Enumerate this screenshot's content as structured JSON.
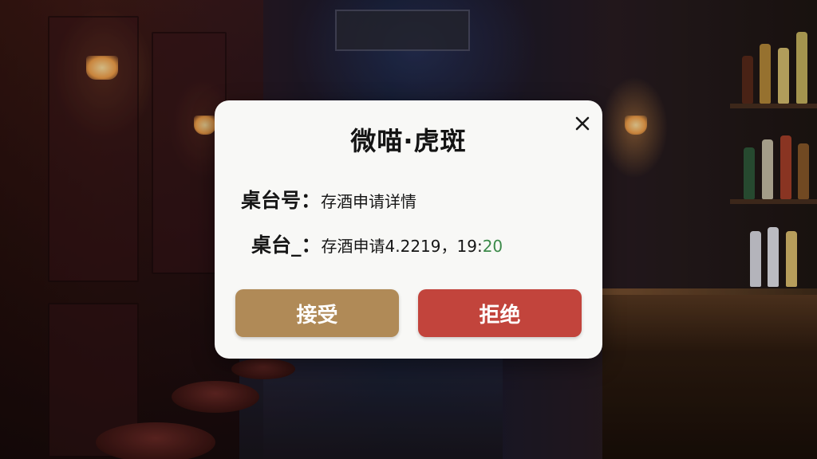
{
  "dialog": {
    "title": "微喵·虎斑",
    "row1": {
      "label": "桌台号：",
      "value": "存酒申请详情"
    },
    "row2": {
      "label": "桌台_：",
      "value": "存酒申请4.2219，19:",
      "value_accent": "20"
    },
    "accept_label": "接受",
    "reject_label": "拒绝"
  },
  "colors": {
    "accept": "#b08a57",
    "reject": "#c2443c",
    "time_accent": "#3c8a4a"
  },
  "icons": {
    "close": "close-icon"
  }
}
